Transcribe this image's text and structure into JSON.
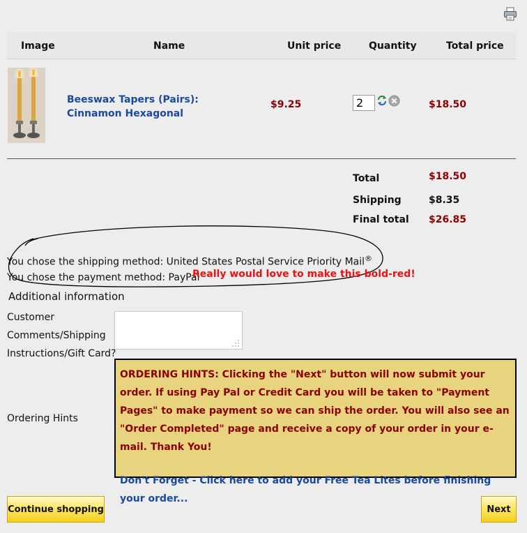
{
  "toolbar": {
    "print_icon": "printer-icon"
  },
  "table": {
    "headers": {
      "image": "Image",
      "name": "Name",
      "unit_price": "Unit price",
      "quantity": "Quantity",
      "total_price": "Total price"
    },
    "row": {
      "name": "Beeswax Tapers (Pairs): Cinnamon Hexagonal",
      "unit_price": "$9.25",
      "quantity": "2",
      "total_price": "$18.50",
      "refresh_icon": "refresh-icon",
      "remove_icon": "remove-icon"
    }
  },
  "totals": {
    "total_label": "Total",
    "total_value": "$18.50",
    "shipping_label": "Shipping",
    "shipping_value": "$8.35",
    "final_label": "Final total",
    "final_value": "$26.85"
  },
  "info": {
    "shipping_text": "You chose the shipping method: United States Postal Service Priority Mail",
    "registered_mark": "®",
    "payment_text": "You chose the payment method: PayPal",
    "annotation": "Really would love to make this bold-red!",
    "additional_heading": "Additional information",
    "comments_label_1": "Customer",
    "comments_label_2": "Comments/Shipping",
    "comments_label_3": "Instructions/Gift Card?",
    "comments_value": "",
    "hints_label": "Ordering Hints",
    "hints_text": "ORDERING HINTS: Clicking the \"Next\" button will now submit your order. If using Pay Pal or Credit Card you will be taken to \"Payment Pages\" to make payment so we can ship the order.  You will also see an \"Order Completed\" page and receive a copy of your order in your e-mail. Thank You!",
    "hints_link": "Don't Forget - Click here to add your Free Tea Lites before finishing your order..."
  },
  "buttons": {
    "continue": "Continue shopping",
    "next": "Next"
  },
  "colors": {
    "price_red": "#8b0000",
    "link_blue": "#1a4aa0",
    "annotation_red": "#ee1111",
    "hints_bg": "#e8d47e",
    "button_yellow": "#ffe766"
  }
}
